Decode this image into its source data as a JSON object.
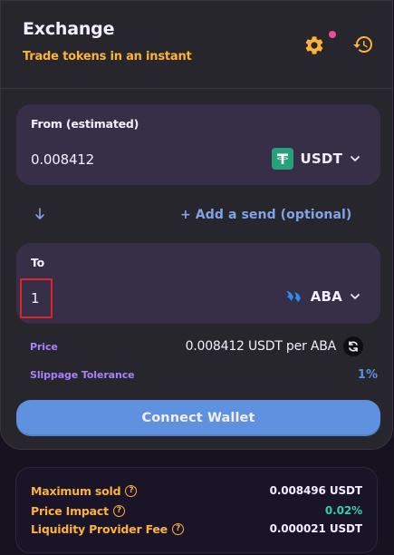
{
  "header": {
    "title": "Exchange",
    "subtitle": "Trade tokens in an instant"
  },
  "from": {
    "label": "From (estimated)",
    "amount": "0.008412",
    "token": "USDT",
    "token_icon": "tether-icon"
  },
  "add_send": "+ Add a send (optional)",
  "to": {
    "label": "To",
    "amount": "1",
    "token": "ABA",
    "token_icon": "aba-icon"
  },
  "price": {
    "label": "Price",
    "value": "0.008412 USDT per ABA"
  },
  "slippage": {
    "label": "Slippage Tolerance",
    "value": "1%"
  },
  "connect_label": "Connect Wallet",
  "summary": {
    "maximum_sold": {
      "label": "Maximum sold",
      "value": "0.008496 USDT"
    },
    "price_impact": {
      "label": "Price Impact",
      "value": "0.02%"
    },
    "lp_fee": {
      "label": "Liquidity Provider Fee",
      "value": "0.000021 USDT"
    }
  },
  "colors": {
    "accent": "#ffb237",
    "primary_button": "#5e92e1",
    "secondary_text": "#a881fc",
    "success": "#31d0aa",
    "notification_dot": "#ed4b9e",
    "highlight": "#e02323"
  }
}
